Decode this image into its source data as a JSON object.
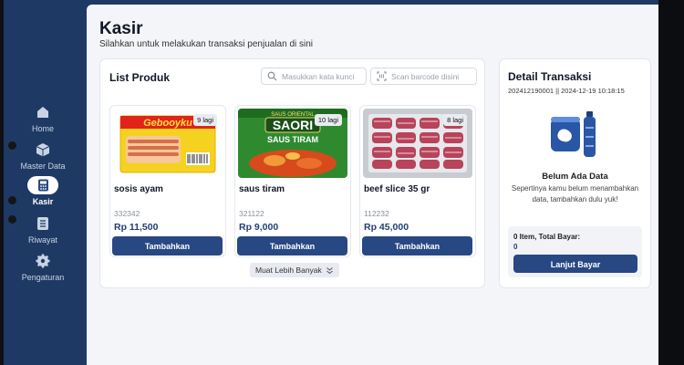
{
  "sidebar": {
    "items": [
      {
        "label": "Home",
        "icon": "home-icon"
      },
      {
        "label": "Master Data",
        "icon": "box-icon"
      },
      {
        "label": "Kasir",
        "icon": "calculator-icon",
        "active": true
      },
      {
        "label": "Riwayat",
        "icon": "list-icon"
      },
      {
        "label": "Pengaturan",
        "icon": "gear-icon"
      }
    ]
  },
  "page": {
    "title": "Kasir",
    "subtitle": "Silahkan untuk melakukan transaksi penjualan di sini"
  },
  "products": {
    "title": "List Produk",
    "search_placeholder": "Masukkan kata kunci",
    "barcode_placeholder": "Scan barcode disini",
    "items": [
      {
        "name": "sosis ayam",
        "code": "332342",
        "price": "Rp 11,500",
        "stock": "9 lagi",
        "button": "Tambahkan"
      },
      {
        "name": "saus tiram",
        "code": "321122",
        "price": "Rp 9,000",
        "stock": "10 lagi",
        "button": "Tambahkan"
      },
      {
        "name": "beef slice 35 gr",
        "code": "112232",
        "price": "Rp 45,000",
        "stock": "8 lagi",
        "button": "Tambahkan"
      }
    ],
    "image_texts": {
      "sosis_brand": "Gebooyku",
      "saori_top": "SAUS ORIENTAL",
      "saori_brand": "SAORI",
      "saori_sub": "SAUS TIRAM"
    },
    "load_more": "Muat Lebih Banyak"
  },
  "detail": {
    "title": "Detail Transaksi",
    "transaction_id": "202412190001 || 2024-12-19 10:18:15",
    "empty_title": "Belum Ada Data",
    "empty_desc": "Sepertinya kamu belum menambahkan data, tambahkan dulu yuk!",
    "summary_label": "0 Item, Total Bayar:",
    "summary_value": "0",
    "pay_button": "Lanjut Bayar"
  },
  "colors": {
    "sidebar": "#1e3a64",
    "primary_button": "#284884",
    "background": "#f3f5f8"
  }
}
